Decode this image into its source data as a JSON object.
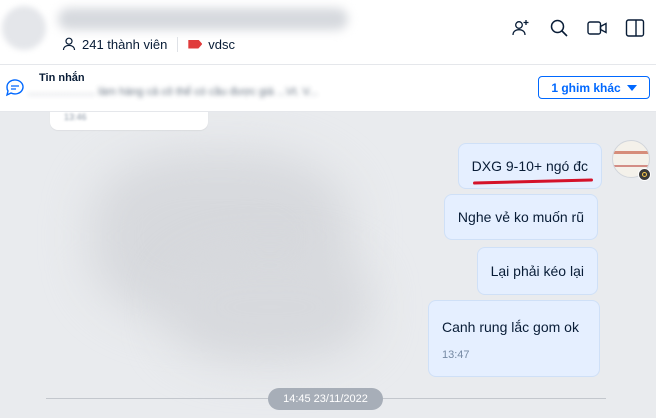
{
  "header": {
    "members_label": "241 thành viên",
    "tag_label": "vdsc",
    "icons": [
      "add-member-icon",
      "search-icon",
      "video-call-icon",
      "sidebar-toggle-icon"
    ],
    "tag_color": "#e03b3b"
  },
  "pinned": {
    "title": "Tin nhắn",
    "preview": "...................... làm hàng cả cô thể có cầu được giá  ...Vt. V...",
    "more_button": "1 ghim khác"
  },
  "messages": [
    {
      "text": "DXG 9-10+ ngó đc",
      "highlighted": true
    },
    {
      "text": "Nghe vẻ ko muốn rũ"
    },
    {
      "text": "Lại phải kéo lại"
    },
    {
      "text": "Canh rung lắc gom ok",
      "time": "13:47"
    }
  ],
  "old_message_time": "13:46",
  "date_divider": "14:45 23/11/2022",
  "colors": {
    "accent": "#0068ff",
    "bubble_bg": "#e5efff",
    "chat_bg": "#e9ebee",
    "underline": "#d4122a"
  }
}
